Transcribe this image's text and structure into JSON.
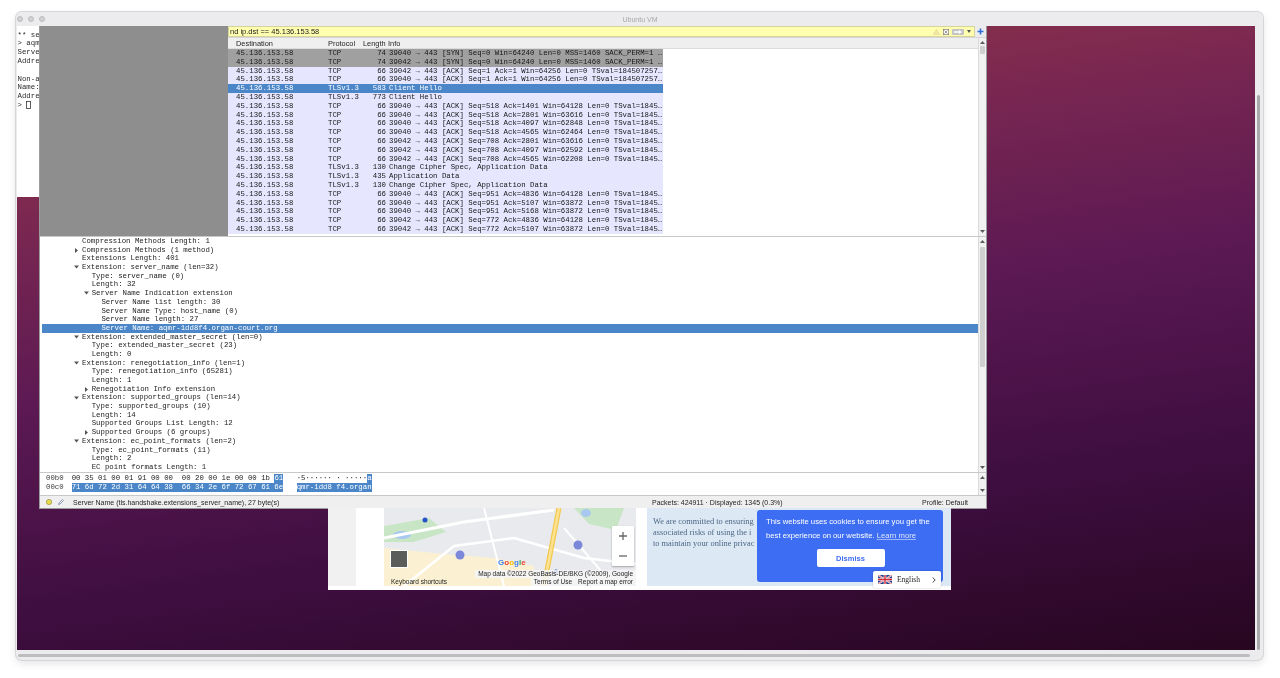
{
  "vm_window": {
    "title": "Ubuntu VM"
  },
  "terminal": {
    "blocks": [
      [
        "** se",
        "> aqm",
        "Serve",
        "Addre"
      ],
      [
        "Non-a",
        "Name:",
        "Addre"
      ]
    ],
    "prompt": ">"
  },
  "wireshark": {
    "filter": {
      "value": "nd ip.dst == 45.136.153.58"
    },
    "packet_list": {
      "columns": [
        "Destination",
        "Protocol",
        "Length",
        "Info"
      ],
      "rows": [
        {
          "destination": "45.136.153.58",
          "protocol": "TCP",
          "length": "74",
          "info": "39040 → 443 [SYN] Seq=0 Win=64240 Len=0 MSS=1460 SACK_PERM=1 …",
          "selected": false,
          "color": "#a0a0a0"
        },
        {
          "destination": "45.136.153.58",
          "protocol": "TCP",
          "length": "74",
          "info": "39042 → 443 [SYN] Seq=0 Win=64240 Len=0 MSS=1460 SACK_PERM=1 …",
          "selected": false,
          "color": "#a0a0a0"
        },
        {
          "destination": "45.136.153.58",
          "protocol": "TCP",
          "length": "66",
          "info": "39042 → 443 [ACK] Seq=1 Ack=1 Win=64256 Len=0 TSval=184507257…",
          "selected": false,
          "color": "#e7e6ff"
        },
        {
          "destination": "45.136.153.58",
          "protocol": "TCP",
          "length": "66",
          "info": "39040 → 443 [ACK] Seq=1 Ack=1 Win=64256 Len=0 TSval=184507257…",
          "selected": false,
          "color": "#e7e6ff"
        },
        {
          "destination": "45.136.153.58",
          "protocol": "TLSv1.3",
          "length": "583",
          "info": "Client Hello",
          "selected": true
        },
        {
          "destination": "45.136.153.58",
          "protocol": "TLSv1.3",
          "length": "773",
          "info": "Client Hello",
          "selected": false,
          "color": "#e7e6ff"
        },
        {
          "destination": "45.136.153.58",
          "protocol": "TCP",
          "length": "66",
          "info": "39040 → 443 [ACK] Seq=518 Ack=1401 Win=64128 Len=0 TSval=1845…",
          "selected": false,
          "color": "#e7e6ff"
        },
        {
          "destination": "45.136.153.58",
          "protocol": "TCP",
          "length": "66",
          "info": "39040 → 443 [ACK] Seq=518 Ack=2801 Win=63616 Len=0 TSval=1845…",
          "selected": false,
          "color": "#e7e6ff"
        },
        {
          "destination": "45.136.153.58",
          "protocol": "TCP",
          "length": "66",
          "info": "39040 → 443 [ACK] Seq=518 Ack=4097 Win=62848 Len=0 TSval=1845…",
          "selected": false,
          "color": "#e7e6ff"
        },
        {
          "destination": "45.136.153.58",
          "protocol": "TCP",
          "length": "66",
          "info": "39040 → 443 [ACK] Seq=518 Ack=4565 Win=62464 Len=0 TSval=1845…",
          "selected": false,
          "color": "#e7e6ff"
        },
        {
          "destination": "45.136.153.58",
          "protocol": "TCP",
          "length": "66",
          "info": "39042 → 443 [ACK] Seq=708 Ack=2801 Win=63616 Len=0 TSval=1845…",
          "selected": false,
          "color": "#e7e6ff"
        },
        {
          "destination": "45.136.153.58",
          "protocol": "TCP",
          "length": "66",
          "info": "39042 → 443 [ACK] Seq=708 Ack=4097 Win=62592 Len=0 TSval=1845…",
          "selected": false,
          "color": "#e7e6ff"
        },
        {
          "destination": "45.136.153.58",
          "protocol": "TCP",
          "length": "66",
          "info": "39042 → 443 [ACK] Seq=708 Ack=4565 Win=62208 Len=0 TSval=1845…",
          "selected": false,
          "color": "#e7e6ff"
        },
        {
          "destination": "45.136.153.58",
          "protocol": "TLSv1.3",
          "length": "130",
          "info": "Change Cipher Spec, Application Data",
          "selected": false,
          "color": "#e7e6ff"
        },
        {
          "destination": "45.136.153.58",
          "protocol": "TLSv1.3",
          "length": "435",
          "info": "Application Data",
          "selected": false,
          "color": "#e7e6ff"
        },
        {
          "destination": "45.136.153.58",
          "protocol": "TLSv1.3",
          "length": "130",
          "info": "Change Cipher Spec, Application Data",
          "selected": false,
          "color": "#e7e6ff"
        },
        {
          "destination": "45.136.153.58",
          "protocol": "TCP",
          "length": "66",
          "info": "39040 → 443 [ACK] Seq=951 Ack=4836 Win=64128 Len=0 TSval=1845…",
          "selected": false,
          "color": "#e7e6ff"
        },
        {
          "destination": "45.136.153.58",
          "protocol": "TCP",
          "length": "66",
          "info": "39040 → 443 [ACK] Seq=951 Ack=5107 Win=63872 Len=0 TSval=1845…",
          "selected": false,
          "color": "#e7e6ff"
        },
        {
          "destination": "45.136.153.58",
          "protocol": "TCP",
          "length": "66",
          "info": "39040 → 443 [ACK] Seq=951 Ack=5168 Win=63872 Len=0 TSval=1845…",
          "selected": false,
          "color": "#e7e6ff"
        },
        {
          "destination": "45.136.153.58",
          "protocol": "TCP",
          "length": "66",
          "info": "39042 → 443 [ACK] Seq=772 Ack=4836 Win=64128 Len=0 TSval=1845…",
          "selected": false,
          "color": "#e7e6ff"
        },
        {
          "destination": "45.136.153.58",
          "protocol": "TCP",
          "length": "66",
          "info": "39042 → 443 [ACK] Seq=772 Ack=5107 Win=63872 Len=0 TSval=1845…",
          "selected": false,
          "color": "#e7e6ff"
        }
      ]
    },
    "details": [
      {
        "label": "Compression Methods Length: 1",
        "selected": false
      },
      {
        "label": "Compression Methods (1 method)",
        "expanded": false,
        "selected": false
      },
      {
        "label": "Extensions Length: 401",
        "selected": false
      },
      {
        "label": "Extension: server_name (len=32)",
        "expanded": true,
        "selected": false,
        "children": [
          {
            "label": "Type: server_name (0)",
            "selected": false
          },
          {
            "label": "Length: 32",
            "selected": false
          },
          {
            "label": "Server Name Indication extension",
            "expanded": true,
            "selected": false,
            "children": [
              {
                "label": "Server Name list length: 30",
                "selected": false
              },
              {
                "label": "Server Name Type: host_name (0)",
                "selected": false
              },
              {
                "label": "Server Name length: 27",
                "selected": false
              },
              {
                "label": "Server Name: aqmr-1dd8f4.organ-court.org",
                "selected": true
              }
            ]
          }
        ]
      },
      {
        "label": "Extension: extended_master_secret (len=0)",
        "expanded": true,
        "selected": false,
        "children": [
          {
            "label": "Type: extended_master_secret (23)",
            "selected": false
          },
          {
            "label": "Length: 0",
            "selected": false
          }
        ]
      },
      {
        "label": "Extension: renegotiation_info (len=1)",
        "expanded": true,
        "selected": false,
        "children": [
          {
            "label": "Type: renegotiation_info (65281)",
            "selected": false
          },
          {
            "label": "Length: 1",
            "selected": false
          },
          {
            "label": "Renegotiation Info extension",
            "expanded": false,
            "selected": false
          }
        ]
      },
      {
        "label": "Extension: supported_groups (len=14)",
        "expanded": true,
        "selected": false,
        "children": [
          {
            "label": "Type: supported_groups (10)",
            "selected": false
          },
          {
            "label": "Length: 14",
            "selected": false
          },
          {
            "label": "Supported Groups List Length: 12",
            "selected": false
          },
          {
            "label": "Supported Groups (6 groups)",
            "expanded": false,
            "selected": false
          }
        ]
      },
      {
        "label": "Extension: ec_point_formats (len=2)",
        "expanded": true,
        "selected": false,
        "children": [
          {
            "label": "Type: ec_point_formats (11)",
            "selected": false
          },
          {
            "label": "Length: 2",
            "selected": false
          },
          {
            "label": "EC point formats Length: 1",
            "selected": false
          }
        ]
      }
    ],
    "bytes": [
      {
        "offset": "00b0",
        "hex": [
          {
            "text": "00 35 01 00 01 91 00 00  00 20 00 1e 00 00 1b",
            "selected": false
          },
          {
            "text": "61",
            "selected": true
          }
        ],
        "ascii": [
          {
            "text": "·5······ · ·····",
            "selected": false
          },
          {
            "text": "a",
            "selected": true
          }
        ]
      },
      {
        "offset": "00c0",
        "hex": [
          {
            "text": "71 6d 72 2d 31 64 64 38  66 34 2e 6f 72 67 61 6e",
            "selected": true
          }
        ],
        "ascii": [
          {
            "text": "qmr-1dd8 f4.organ",
            "selected": true
          }
        ]
      }
    ],
    "status_bar": {
      "field": "Server Name (tls.handshake.extensions_server_name), 27 byte(s)",
      "packets": "Packets: 424911 · Displayed: 1345 (0.3%)",
      "profile": "Profile: Default"
    }
  },
  "browser": {
    "map": {
      "logo": "Google",
      "shortcuts_link": "Keyboard shortcuts",
      "attribution": "Map data ©2022 GeoBasis-DE/BKG (©2009), Google",
      "links": [
        "Terms of Use",
        "Report a map error"
      ]
    },
    "notice": {
      "lines": [
        "We are committed to ensuring",
        "associated risks of using the i",
        "to maintain your online privac"
      ]
    },
    "cookie_banner": {
      "message": "This website uses cookies to ensure you get the best experience on our website.",
      "link": "Learn more",
      "button": "Dismiss"
    },
    "language_selector": {
      "label": "English"
    }
  }
}
